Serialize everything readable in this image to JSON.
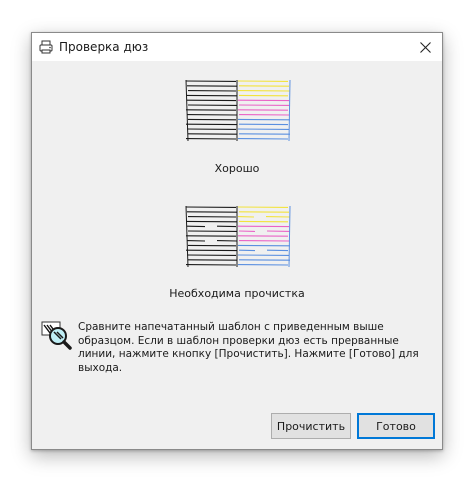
{
  "window": {
    "title": "Проверка дюз",
    "close_glyph": "✕"
  },
  "patterns": {
    "good_label": "Хорошо",
    "bad_label": "Необходима прочистка",
    "colors": {
      "black": "#1a1a1a",
      "yellow": "#f2e33c",
      "magenta": "#ea63c6",
      "cyan": "#5a8fe0"
    }
  },
  "message": {
    "text": "Сравните напечатанный шаблон с приведенным выше образцом. Если в шаблон проверки дюз есть прерванные линии, нажмите кнопку [Прочистить]. Нажмите [Готово] для выхода."
  },
  "buttons": {
    "clean_label": "Прочистить",
    "done_label": "Готово"
  },
  "icons": {
    "title": "printer-nozzle-icon",
    "message": "magnifier-nozzle-icon",
    "close": "close-icon"
  }
}
